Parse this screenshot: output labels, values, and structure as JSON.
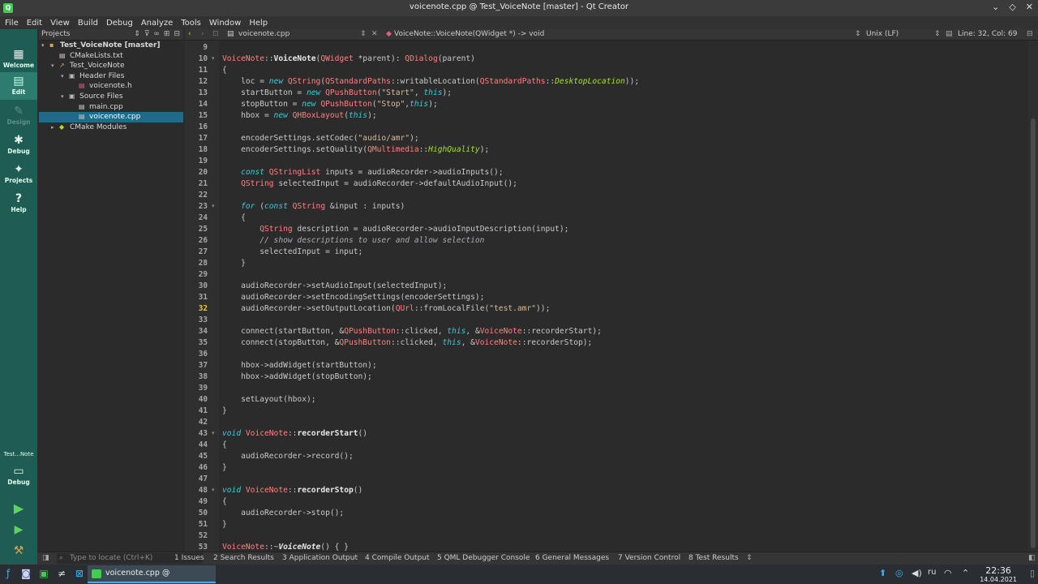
{
  "window": {
    "title": "voicenote.cpp @ Test_VoiceNote [master] - Qt Creator"
  },
  "menu": [
    "File",
    "Edit",
    "View",
    "Build",
    "Debug",
    "Analyze",
    "Tools",
    "Window",
    "Help"
  ],
  "modes": {
    "welcome": "Welcome",
    "edit": "Edit",
    "design": "Design",
    "debug": "Debug",
    "projects": "Projects",
    "help": "Help",
    "kit_name": "Test...Note",
    "kit_mode": "Debug"
  },
  "projects_panel": {
    "header": "Projects",
    "tree": [
      {
        "label": "Test_VoiceNote [master]",
        "depth": 0,
        "bold": true,
        "arrow": "▾",
        "icon": "project-icon"
      },
      {
        "label": "CMakeLists.txt",
        "depth": 1,
        "arrow": "",
        "icon": "cmake-file-icon"
      },
      {
        "label": "Test_VoiceNote",
        "depth": 1,
        "arrow": "▾",
        "icon": "target-icon"
      },
      {
        "label": "Header Files",
        "depth": 2,
        "arrow": "▾",
        "icon": "folder-icon"
      },
      {
        "label": "voicenote.h",
        "depth": 3,
        "arrow": "",
        "icon": "header-file-icon"
      },
      {
        "label": "Source Files",
        "depth": 2,
        "arrow": "▾",
        "icon": "folder-icon"
      },
      {
        "label": "main.cpp",
        "depth": 3,
        "arrow": "",
        "icon": "cpp-file-icon"
      },
      {
        "label": "voicenote.cpp",
        "depth": 3,
        "arrow": "",
        "icon": "cpp-file-icon",
        "selected": true
      },
      {
        "label": "CMake Modules",
        "depth": 1,
        "arrow": "▸",
        "icon": "cmake-modules-icon"
      }
    ]
  },
  "editor_toolbar": {
    "file": "voicenote.cpp",
    "symbol": "VoiceNote::VoiceNote(QWidget *) -> void",
    "line_ending": "Unix (LF)",
    "position": "Line: 32, Col: 69"
  },
  "editor": {
    "current_line": 32,
    "lines": [
      {
        "n": 9,
        "t": ""
      },
      {
        "n": 10,
        "t": "VoiceNote::VoiceNote(QWidget *parent): QDialog(parent)",
        "fold": true
      },
      {
        "n": 11,
        "t": "{"
      },
      {
        "n": 12,
        "t": "    loc = new QString(QStandardPaths::writableLocation(QStandardPaths::DesktopLocation));"
      },
      {
        "n": 13,
        "t": "    startButton = new QPushButton(\"Start\", this);"
      },
      {
        "n": 14,
        "t": "    stopButton = new QPushButton(\"Stop\",this);"
      },
      {
        "n": 15,
        "t": "    hbox = new QHBoxLayout(this);"
      },
      {
        "n": 16,
        "t": ""
      },
      {
        "n": 17,
        "t": "    encoderSettings.setCodec(\"audio/amr\");"
      },
      {
        "n": 18,
        "t": "    encoderSettings.setQuality(QMultimedia::HighQuality);"
      },
      {
        "n": 19,
        "t": ""
      },
      {
        "n": 20,
        "t": "    const QStringList inputs = audioRecorder->audioInputs();"
      },
      {
        "n": 21,
        "t": "    QString selectedInput = audioRecorder->defaultAudioInput();"
      },
      {
        "n": 22,
        "t": ""
      },
      {
        "n": 23,
        "t": "    for (const QString &input : inputs)",
        "fold": true
      },
      {
        "n": 24,
        "t": "    {"
      },
      {
        "n": 25,
        "t": "        QString description = audioRecorder->audioInputDescription(input);"
      },
      {
        "n": 26,
        "t": "        // show descriptions to user and allow selection"
      },
      {
        "n": 27,
        "t": "        selectedInput = input;"
      },
      {
        "n": 28,
        "t": "    }"
      },
      {
        "n": 29,
        "t": ""
      },
      {
        "n": 30,
        "t": "    audioRecorder->setAudioInput(selectedInput);"
      },
      {
        "n": 31,
        "t": "    audioRecorder->setEncodingSettings(encoderSettings);"
      },
      {
        "n": 32,
        "t": "    audioRecorder->setOutputLocation(QUrl::fromLocalFile(\"test.amr\"));"
      },
      {
        "n": 33,
        "t": ""
      },
      {
        "n": 34,
        "t": "    connect(startButton, &QPushButton::clicked, this, &VoiceNote::recorderStart);"
      },
      {
        "n": 35,
        "t": "    connect(stopButton, &QPushButton::clicked, this, &VoiceNote::recorderStop);"
      },
      {
        "n": 36,
        "t": ""
      },
      {
        "n": 37,
        "t": "    hbox->addWidget(startButton);"
      },
      {
        "n": 38,
        "t": "    hbox->addWidget(stopButton);"
      },
      {
        "n": 39,
        "t": ""
      },
      {
        "n": 40,
        "t": "    setLayout(hbox);"
      },
      {
        "n": 41,
        "t": "}"
      },
      {
        "n": 42,
        "t": ""
      },
      {
        "n": 43,
        "t": "void VoiceNote::recorderStart()",
        "fold": true
      },
      {
        "n": 44,
        "t": "{"
      },
      {
        "n": 45,
        "t": "    audioRecorder->record();"
      },
      {
        "n": 46,
        "t": "}"
      },
      {
        "n": 47,
        "t": ""
      },
      {
        "n": 48,
        "t": "void VoiceNote::recorderStop()",
        "fold": true
      },
      {
        "n": 49,
        "t": "{"
      },
      {
        "n": 50,
        "t": "    audioRecorder->stop();"
      },
      {
        "n": 51,
        "t": "}"
      },
      {
        "n": 52,
        "t": ""
      },
      {
        "n": 53,
        "t": "VoiceNote::~VoiceNote() { }"
      }
    ]
  },
  "output_bar": {
    "locate_placeholder": "Type to locate (Ctrl+K)",
    "tabs": [
      "1 Issues",
      "2 Search Results",
      "3 Application Output",
      "4 Compile Output",
      "5 QML Debugger Console",
      "6 General Messages",
      "7 Version Control",
      "8 Test Results"
    ]
  },
  "taskbar": {
    "active_task": "voicenote.cpp @ Test_Voice...",
    "language": "ru",
    "time": "22:36",
    "date": "14.04.2021"
  },
  "colors": {
    "mode_bar": "#1f5c53",
    "selection": "#1f6b8a",
    "qt_green": "#41cd52"
  }
}
